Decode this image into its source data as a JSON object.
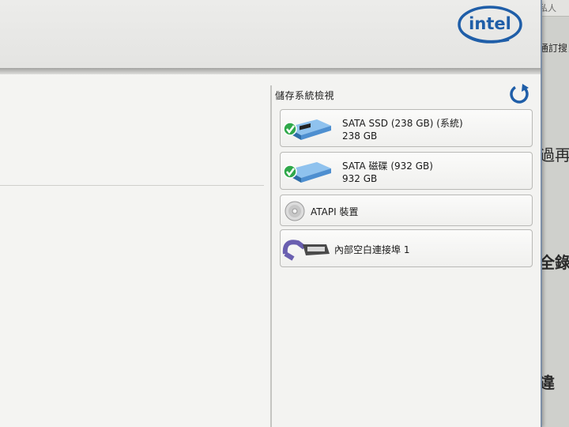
{
  "brand": {
    "logo_text": "intel"
  },
  "storage_view": {
    "title": "儲存系統檢視",
    "devices": [
      {
        "name": "SATA SSD (238 GB) (系統)",
        "size": "238 GB",
        "status": "ok",
        "icon": "ssd-icon"
      },
      {
        "name": "SATA 磁碟 (932 GB)",
        "size": "932 GB",
        "status": "ok",
        "icon": "hard-disk-icon"
      },
      {
        "name": "ATAPI 裝置",
        "icon": "optical-disc-icon"
      },
      {
        "name": "內部空白連接埠 1",
        "icon": "internal-port-icon"
      }
    ]
  },
  "background_window": {
    "fragments": [
      "私人",
      "通訂搜ヌ",
      "過再",
      "全錄",
      "違"
    ]
  },
  "colors": {
    "accent": "#1f5ea8",
    "status_ok": "#2fa84a",
    "drive_blue": "#4e8fd0",
    "window_border": "#7d8fa6"
  }
}
